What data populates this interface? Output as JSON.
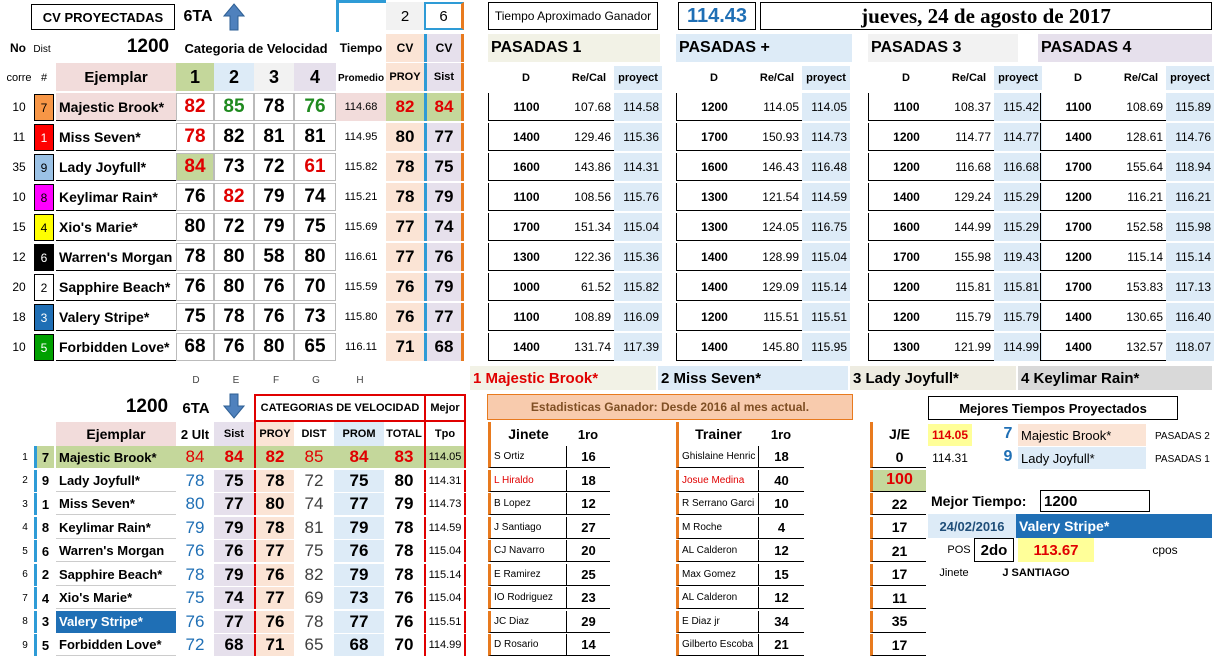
{
  "top": {
    "title": "CV PROYECTADAS",
    "race": "6TA",
    "n2": "2",
    "n6": "6",
    "tiempo_label": "Tiempo Aproximado Ganador",
    "tiempo_val": "114.43",
    "date": "jueves, 24 de agosto de 2017"
  },
  "hdr": {
    "no": "No",
    "dist": "Dist",
    "distval": "1200",
    "catvel": "Categoria de Velocidad",
    "tiempo": "Tiempo",
    "cv1": "CV",
    "cv2": "CV",
    "corre": "corre",
    "hash": "#",
    "ejemplar": "Ejemplar",
    "c1": "1",
    "c2": "2",
    "c3": "3",
    "c4": "4",
    "promedio": "Promedio",
    "proy": "PROY",
    "sist": "Sist"
  },
  "pasadas": {
    "p1": "PASADAS 1",
    "p2": "PASADAS +",
    "p3": "PASADAS 3",
    "p4": "PASADAS 4",
    "d": "D",
    "recal": "Re/Cal",
    "proyect": "proyect"
  },
  "horses": [
    {
      "corre": "10",
      "num": "7",
      "name": "Majestic Brook*",
      "cv": [
        "82",
        "85",
        "78",
        "76"
      ],
      "prom": "114.68",
      "proy": "82",
      "sist": "84",
      "p": [
        [
          "1100",
          "107.68",
          "114.58"
        ],
        [
          "1200",
          "114.05",
          "114.05"
        ],
        [
          "1100",
          "108.37",
          "115.42"
        ],
        [
          "1100",
          "108.69",
          "115.89"
        ]
      ]
    },
    {
      "corre": "11",
      "num": "1",
      "name": "Miss Seven*",
      "cv": [
        "78",
        "82",
        "81",
        "81"
      ],
      "prom": "114.95",
      "proy": "80",
      "sist": "77",
      "p": [
        [
          "1400",
          "129.46",
          "115.36"
        ],
        [
          "1700",
          "150.93",
          "114.73"
        ],
        [
          "1200",
          "114.77",
          "114.77"
        ],
        [
          "1400",
          "128.61",
          "114.76"
        ]
      ]
    },
    {
      "corre": "35",
      "num": "9",
      "name": "Lady Joyfull*",
      "cv": [
        "84",
        "73",
        "72",
        "61"
      ],
      "prom": "115.82",
      "proy": "78",
      "sist": "75",
      "p": [
        [
          "1600",
          "143.86",
          "114.31"
        ],
        [
          "1600",
          "146.43",
          "116.48"
        ],
        [
          "1200",
          "116.68",
          "116.68"
        ],
        [
          "1700",
          "155.64",
          "118.94"
        ]
      ]
    },
    {
      "corre": "10",
      "num": "8",
      "name": "Keylimar Rain*",
      "cv": [
        "76",
        "82",
        "79",
        "74"
      ],
      "prom": "115.21",
      "proy": "78",
      "sist": "79",
      "p": [
        [
          "1100",
          "108.56",
          "115.76"
        ],
        [
          "1300",
          "121.54",
          "114.59"
        ],
        [
          "1400",
          "129.24",
          "115.29"
        ],
        [
          "1200",
          "116.21",
          "116.21"
        ]
      ]
    },
    {
      "corre": "15",
      "num": "4",
      "name": "Xio's Marie*",
      "cv": [
        "80",
        "72",
        "79",
        "75"
      ],
      "prom": "115.69",
      "proy": "77",
      "sist": "74",
      "p": [
        [
          "1700",
          "151.34",
          "115.04"
        ],
        [
          "1300",
          "124.05",
          "116.75"
        ],
        [
          "1600",
          "144.99",
          "115.29"
        ],
        [
          "1700",
          "152.58",
          "115.98"
        ]
      ]
    },
    {
      "corre": "12",
      "num": "6",
      "name": "Warren's Morgan",
      "cv": [
        "78",
        "80",
        "58",
        "80"
      ],
      "prom": "116.61",
      "proy": "77",
      "sist": "76",
      "p": [
        [
          "1300",
          "122.36",
          "115.36"
        ],
        [
          "1400",
          "128.99",
          "115.04"
        ],
        [
          "1700",
          "155.98",
          "119.43"
        ],
        [
          "1200",
          "115.14",
          "115.14"
        ]
      ]
    },
    {
      "corre": "20",
      "num": "2",
      "name": "Sapphire Beach*",
      "cv": [
        "76",
        "80",
        "76",
        "70"
      ],
      "prom": "115.59",
      "proy": "76",
      "sist": "79",
      "p": [
        [
          "1000",
          "61.52",
          "115.82"
        ],
        [
          "1400",
          "129.09",
          "115.14"
        ],
        [
          "1200",
          "115.81",
          "115.81"
        ],
        [
          "1700",
          "153.83",
          "117.13"
        ]
      ]
    },
    {
      "corre": "18",
      "num": "3",
      "name": "Valery Stripe*",
      "cv": [
        "75",
        "78",
        "76",
        "73"
      ],
      "prom": "115.80",
      "proy": "76",
      "sist": "77",
      "p": [
        [
          "1100",
          "108.89",
          "116.09"
        ],
        [
          "1200",
          "115.51",
          "115.51"
        ],
        [
          "1200",
          "115.79",
          "115.79"
        ],
        [
          "1400",
          "130.65",
          "116.40"
        ]
      ]
    },
    {
      "corre": "10",
      "num": "5",
      "name": "Forbidden Love*",
      "cv": [
        "68",
        "76",
        "80",
        "65"
      ],
      "prom": "116.11",
      "proy": "71",
      "sist": "68",
      "p": [
        [
          "1400",
          "131.74",
          "117.39"
        ],
        [
          "1400",
          "145.80",
          "115.95"
        ],
        [
          "1300",
          "121.99",
          "114.99"
        ],
        [
          "1400",
          "132.57",
          "118.07"
        ]
      ]
    }
  ],
  "picks": [
    "1 Majestic Brook*",
    "2 Miss Seven*",
    "3 Lady Joyfull*",
    "4 Keylimar Rain*"
  ],
  "colletters": [
    "D",
    "E",
    "F",
    "G",
    "H"
  ],
  "bottom": {
    "dist": "1200",
    "race": "6TA",
    "catvel": "CATEGORIAS DE VELOCIDAD",
    "mejor": "Mejor",
    "ejemplar": "Ejemplar",
    "ult": "2 Ult",
    "sist": "Sist",
    "proy": "PROY",
    "dist2": "DIST",
    "prom": "PROM",
    "total": "TOTAL",
    "tpo": "Tpo",
    "rows": [
      {
        "i": "1",
        "num": "7",
        "name": "Majestic Brook*",
        "ult": "84",
        "sist": "84",
        "proy": "82",
        "dist": "85",
        "prom": "84",
        "total": "83",
        "tpo": "114.05"
      },
      {
        "i": "2",
        "num": "9",
        "name": "Lady Joyfull*",
        "ult": "78",
        "sist": "75",
        "proy": "78",
        "dist": "72",
        "prom": "75",
        "total": "80",
        "tpo": "114.31"
      },
      {
        "i": "3",
        "num": "1",
        "name": "Miss Seven*",
        "ult": "80",
        "sist": "77",
        "proy": "80",
        "dist": "74",
        "prom": "77",
        "total": "79",
        "tpo": "114.73"
      },
      {
        "i": "4",
        "num": "8",
        "name": "Keylimar Rain*",
        "ult": "79",
        "sist": "79",
        "proy": "78",
        "dist": "81",
        "prom": "79",
        "total": "78",
        "tpo": "114.59"
      },
      {
        "i": "5",
        "num": "6",
        "name": "Warren's Morgan",
        "ult": "76",
        "sist": "76",
        "proy": "77",
        "dist": "75",
        "prom": "76",
        "total": "78",
        "tpo": "115.04"
      },
      {
        "i": "6",
        "num": "2",
        "name": "Sapphire Beach*",
        "ult": "78",
        "sist": "79",
        "proy": "76",
        "dist": "82",
        "prom": "79",
        "total": "78",
        "tpo": "115.14"
      },
      {
        "i": "7",
        "num": "4",
        "name": "Xio's Marie*",
        "ult": "75",
        "sist": "74",
        "proy": "77",
        "dist": "69",
        "prom": "73",
        "total": "76",
        "tpo": "115.04"
      },
      {
        "i": "8",
        "num": "3",
        "name": "Valery Stripe*",
        "ult": "76",
        "sist": "77",
        "proy": "76",
        "dist": "78",
        "prom": "77",
        "total": "76",
        "tpo": "115.51"
      },
      {
        "i": "9",
        "num": "5",
        "name": "Forbidden Love*",
        "ult": "72",
        "sist": "68",
        "proy": "71",
        "dist": "65",
        "prom": "68",
        "total": "70",
        "tpo": "114.99"
      }
    ]
  },
  "stats": {
    "title": "Estadisticas  Ganador: Desde 2016 al mes actual.",
    "jinete": "Jinete",
    "first": "1ro",
    "trainer": "Trainer",
    "first2": "1ro",
    "je": "J/E",
    "rows": [
      {
        "j": "S Ortiz",
        "j1": "16",
        "t": "Ghislaine Henric",
        "t1": "18",
        "je": "0"
      },
      {
        "j": "L Hiraldo",
        "j1": "18",
        "t": "Josue Medina",
        "t1": "40",
        "je": "100"
      },
      {
        "j": "B Lopez",
        "j1": "12",
        "t": "R Serrano Garci",
        "t1": "10",
        "je": "22"
      },
      {
        "j": "J Santiago",
        "j1": "27",
        "t": "M Roche",
        "t1": "4",
        "je": "17"
      },
      {
        "j": "CJ Navarro",
        "j1": "20",
        "t": "AL Calderon",
        "t1": "12",
        "je": "21"
      },
      {
        "j": "E Ramirez",
        "j1": "25",
        "t": "Max Gomez",
        "t1": "15",
        "je": "17"
      },
      {
        "j": "IO Rodriguez",
        "j1": "23",
        "t": "AL Calderon",
        "t1": "12",
        "je": "11"
      },
      {
        "j": "JC Diaz",
        "j1": "29",
        "t": "E Diaz jr",
        "t1": "34",
        "je": "35"
      },
      {
        "j": "D Rosario",
        "j1": "14",
        "t": "Gilberto Escoba",
        "t1": "21",
        "je": "17"
      }
    ]
  },
  "mejores": {
    "title": "Mejores Tiempos Proyectados",
    "t1": "114.05",
    "n1": "7",
    "h1": "Majestic Brook*",
    "p1": "PASADAS 2",
    "t2": "114.31",
    "n2": "9",
    "h2": "Lady Joyfull*",
    "p2": "PASADAS 1",
    "mt": "Mejor Tiempo:",
    "mtval": "1200",
    "date": "24/02/2016",
    "horse": "Valery Stripe*",
    "pos": "POS",
    "posval": "2do",
    "time": "113.67",
    "cpos": "cpos",
    "jinete": "Jinete",
    "jval": "J SANTIAGO"
  }
}
